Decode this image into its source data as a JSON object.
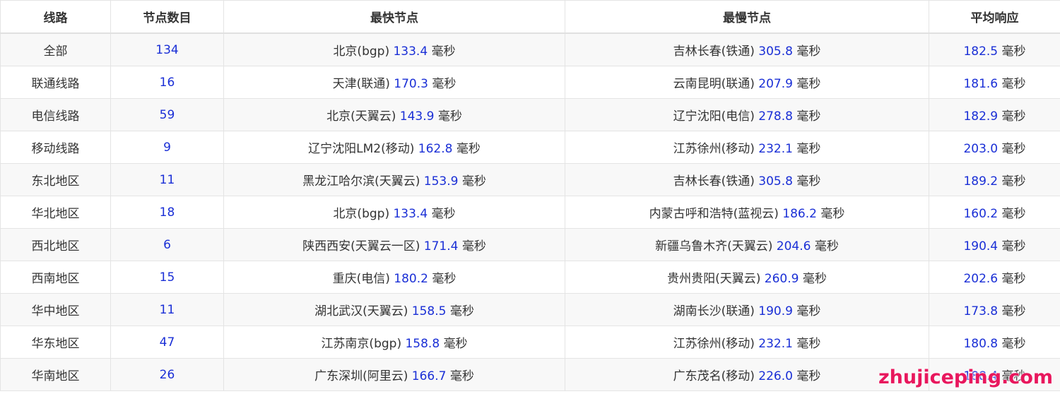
{
  "headers": [
    "线路",
    "节点数目",
    "最快节点",
    "最慢节点",
    "平均响应"
  ],
  "unit": "毫秒",
  "rows": [
    {
      "line": "全部",
      "count": "134",
      "fast_name": "北京(bgp)",
      "fast_ms": "133.4",
      "slow_name": "吉林长春(铁通)",
      "slow_ms": "305.8",
      "avg_ms": "182.5"
    },
    {
      "line": "联通线路",
      "count": "16",
      "fast_name": "天津(联通)",
      "fast_ms": "170.3",
      "slow_name": "云南昆明(联通)",
      "slow_ms": "207.9",
      "avg_ms": "181.6"
    },
    {
      "line": "电信线路",
      "count": "59",
      "fast_name": "北京(天翼云)",
      "fast_ms": "143.9",
      "slow_name": "辽宁沈阳(电信)",
      "slow_ms": "278.8",
      "avg_ms": "182.9"
    },
    {
      "line": "移动线路",
      "count": "9",
      "fast_name": "辽宁沈阳LM2(移动)",
      "fast_ms": "162.8",
      "slow_name": "江苏徐州(移动)",
      "slow_ms": "232.1",
      "avg_ms": "203.0"
    },
    {
      "line": "东北地区",
      "count": "11",
      "fast_name": "黑龙江哈尔滨(天翼云)",
      "fast_ms": "153.9",
      "slow_name": "吉林长春(铁通)",
      "slow_ms": "305.8",
      "avg_ms": "189.2"
    },
    {
      "line": "华北地区",
      "count": "18",
      "fast_name": "北京(bgp)",
      "fast_ms": "133.4",
      "slow_name": "内蒙古呼和浩特(蓝视云)",
      "slow_ms": "186.2",
      "avg_ms": "160.2"
    },
    {
      "line": "西北地区",
      "count": "6",
      "fast_name": "陕西西安(天翼云一区)",
      "fast_ms": "171.4",
      "slow_name": "新疆乌鲁木齐(天翼云)",
      "slow_ms": "204.6",
      "avg_ms": "190.4"
    },
    {
      "line": "西南地区",
      "count": "15",
      "fast_name": "重庆(电信)",
      "fast_ms": "180.2",
      "slow_name": "贵州贵阳(天翼云)",
      "slow_ms": "260.9",
      "avg_ms": "202.6"
    },
    {
      "line": "华中地区",
      "count": "11",
      "fast_name": "湖北武汉(天翼云)",
      "fast_ms": "158.5",
      "slow_name": "湖南长沙(联通)",
      "slow_ms": "190.9",
      "avg_ms": "173.8"
    },
    {
      "line": "华东地区",
      "count": "47",
      "fast_name": "江苏南京(bgp)",
      "fast_ms": "158.8",
      "slow_name": "江苏徐州(移动)",
      "slow_ms": "232.1",
      "avg_ms": "180.8"
    },
    {
      "line": "华南地区",
      "count": "26",
      "fast_name": "广东深圳(阿里云)",
      "fast_ms": "166.7",
      "slow_name": "广东茂名(移动)",
      "slow_ms": "226.0",
      "avg_ms": "188.4"
    }
  ],
  "watermark": "zhujiceping.com",
  "colors": {
    "value": "#1a2fd6",
    "watermark": "#e8175d",
    "stripe": "#f8f8f8"
  }
}
